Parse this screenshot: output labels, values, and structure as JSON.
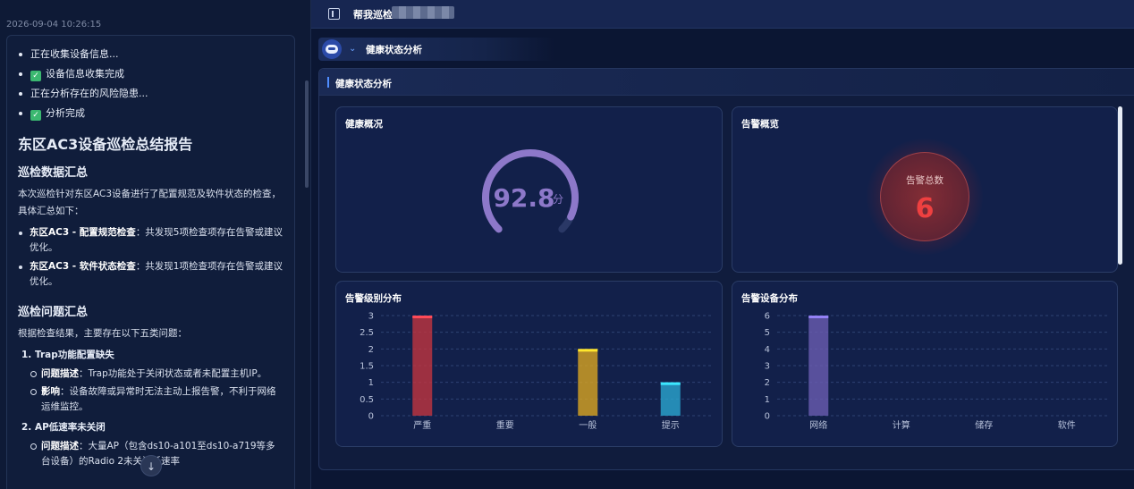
{
  "chat": {
    "timestamp": "2026-09-04 10:26:15",
    "status_items": [
      {
        "text": "正在收集设备信息...",
        "checked": false
      },
      {
        "text": "设备信息收集完成",
        "checked": true
      },
      {
        "text": "正在分析存在的风险隐患...",
        "checked": false
      },
      {
        "text": "分析完成",
        "checked": true
      }
    ],
    "report_title": "东区AC3设备巡检总结报告",
    "section1_title": "巡检数据汇总",
    "section1_text": "本次巡检针对东区AC3设备进行了配置规范及软件状态的检查，具体汇总如下：",
    "section1_items": [
      {
        "label": "东区AC3 - 配置规范检查",
        "text": "：共发现5项检查项存在告警或建议优化。"
      },
      {
        "label": "东区AC3 - 软件状态检查",
        "text": "：共发现1项检查项存在告警或建议优化。"
      }
    ],
    "section2_title": "巡检问题汇总",
    "section2_text": "根据检查结果，主要存在以下五类问题：",
    "problem1_title": "1. Trap功能配置缺失",
    "problem1_items": [
      {
        "label": "问题描述",
        "text": "：Trap功能处于关闭状态或者未配置主机IP。"
      },
      {
        "label": "影响",
        "text": "：设备故障或异常时无法主动上报告警，不利于网络运维监控。"
      }
    ],
    "problem2_title": "2. AP低速率未关闭",
    "problem2_item": {
      "label": "问题描述",
      "text": "：大量AP（包含ds10-a101至ds10-a719等多台设备）的Radio 2未关闭低速率"
    },
    "scroll_down_icon": "arrow-down-icon"
  },
  "topbar": {
    "title": "帮我巡检",
    "panel_icon": "sidebar-toggle-icon"
  },
  "assistant": {
    "label": "健康状态分析",
    "avatar_icon": "robot-icon",
    "chevron_icon": "chevron-double-down-icon"
  },
  "panel": {
    "title": "健康状态分析"
  },
  "health": {
    "title": "健康概况",
    "score": "92.8",
    "unit": "分",
    "score_value": 92.8,
    "color": "#8d78c9"
  },
  "alarm_overview": {
    "title": "告警概览",
    "label": "告警总数",
    "count": "6",
    "color": "#ee4040"
  },
  "chart_data": [
    {
      "type": "bar",
      "title": "告警级别分布",
      "categories": [
        "严重",
        "重要",
        "一般",
        "提示"
      ],
      "values": [
        3,
        0,
        2,
        1
      ],
      "colors": [
        "#c0353f",
        "#c0353f",
        "#d9a520",
        "#2ba6cf"
      ],
      "yticks": [
        "0",
        "0.5",
        "1",
        "1.5",
        "2",
        "2.5",
        "3"
      ],
      "ylim": [
        0,
        3
      ],
      "grid": true
    },
    {
      "type": "bar",
      "title": "告警设备分布",
      "categories": [
        "网络",
        "计算",
        "储存",
        "软件"
      ],
      "values": [
        6,
        0,
        0,
        0
      ],
      "colors": [
        "#6a5cb0",
        "#6a5cb0",
        "#6a5cb0",
        "#6a5cb0"
      ],
      "yticks": [
        "0",
        "1",
        "2",
        "3",
        "4",
        "5",
        "6"
      ],
      "ylim": [
        0,
        6
      ],
      "grid": true
    }
  ]
}
